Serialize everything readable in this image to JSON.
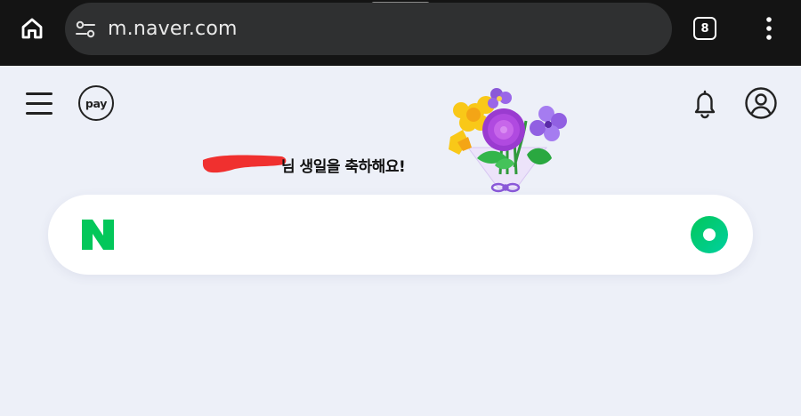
{
  "browser": {
    "url": "m.naver.com",
    "tab_count": "8"
  },
  "header": {
    "pay_label": "pay"
  },
  "greeting": {
    "text": "님 생일을 축하해요!"
  },
  "search": {
    "logo_letter": "N"
  },
  "colors": {
    "naver_green": "#03c75a",
    "page_background": "#edf0f8",
    "browser_bar": "#141414",
    "redaction": "#f0302f"
  }
}
